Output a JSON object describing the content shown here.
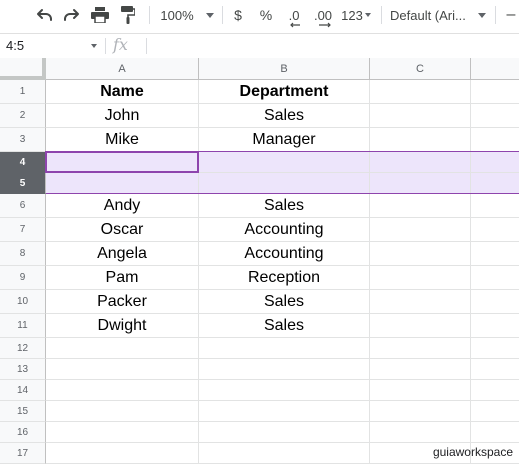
{
  "toolbar": {
    "zoom": "100%",
    "currency": "$",
    "percent": "%",
    "decrease_decimal": ".0",
    "increase_decimal": ".00",
    "more_formats": "123",
    "font": "Default (Ari..."
  },
  "formula_bar": {
    "name_box": "4:5",
    "fx_label": "fx",
    "formula": ""
  },
  "columns": [
    "A",
    "B",
    "C"
  ],
  "rows": [
    {
      "num": "1",
      "a": "Name",
      "b": "Department",
      "c": "",
      "header": true
    },
    {
      "num": "2",
      "a": "John",
      "b": "Sales",
      "c": ""
    },
    {
      "num": "3",
      "a": "Mike",
      "b": "Manager",
      "c": ""
    },
    {
      "num": "4",
      "a": "",
      "b": "",
      "c": "",
      "selected": true
    },
    {
      "num": "5",
      "a": "",
      "b": "",
      "c": "",
      "selected": true
    },
    {
      "num": "6",
      "a": "Andy",
      "b": "Sales",
      "c": ""
    },
    {
      "num": "7",
      "a": "Oscar",
      "b": "Accounting",
      "c": ""
    },
    {
      "num": "8",
      "a": "Angela",
      "b": "Accounting",
      "c": ""
    },
    {
      "num": "9",
      "a": "Pam",
      "b": "Reception",
      "c": ""
    },
    {
      "num": "10",
      "a": "Packer",
      "b": "Sales",
      "c": ""
    },
    {
      "num": "11",
      "a": "Dwight",
      "b": "Sales",
      "c": ""
    },
    {
      "num": "12",
      "a": "",
      "b": "",
      "c": ""
    },
    {
      "num": "13",
      "a": "",
      "b": "",
      "c": ""
    },
    {
      "num": "14",
      "a": "",
      "b": "",
      "c": ""
    },
    {
      "num": "15",
      "a": "",
      "b": "",
      "c": ""
    },
    {
      "num": "16",
      "a": "",
      "b": "",
      "c": ""
    },
    {
      "num": "17",
      "a": "",
      "b": "",
      "c": ""
    }
  ],
  "watermark": "guiaworkspace",
  "colors": {
    "selection_fill": "#ede5fb",
    "selection_border": "#8e44ad",
    "selected_row_header": "#5f6368"
  }
}
